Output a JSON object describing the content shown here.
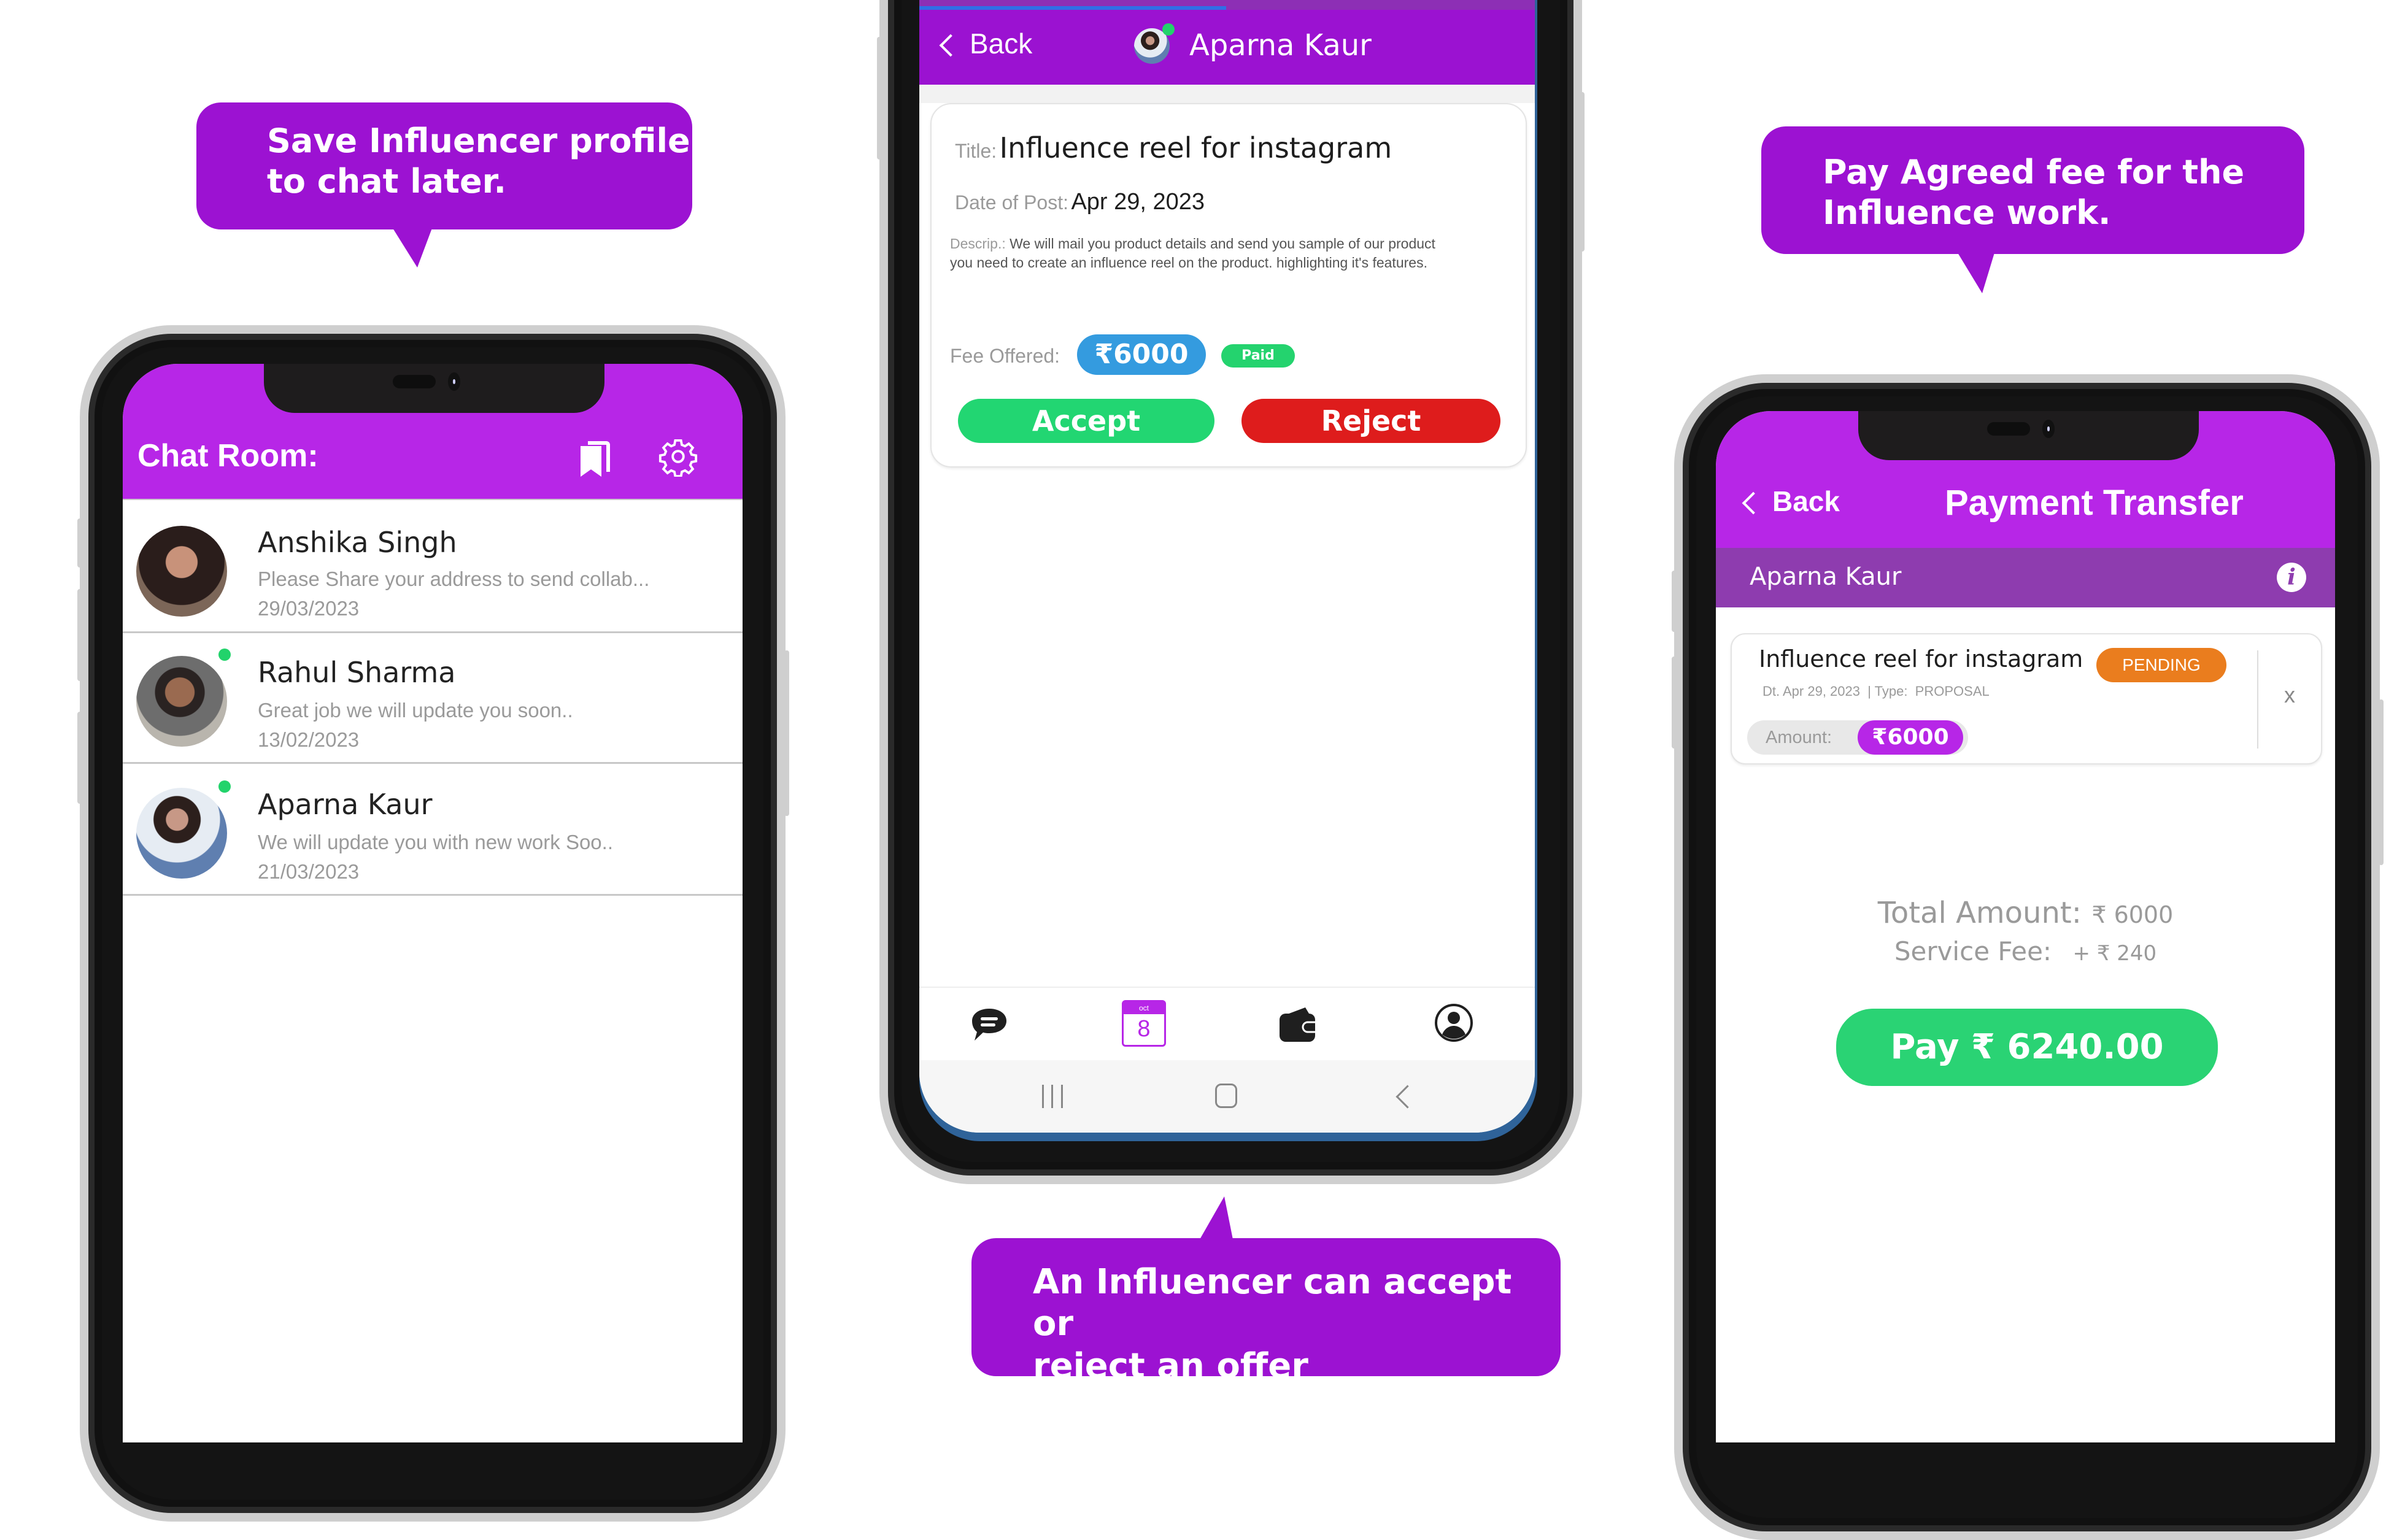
{
  "callouts": {
    "left": {
      "line1": "Save Influencer profile",
      "line2": "to chat later."
    },
    "middle": {
      "line1": "An Influencer can accept or",
      "line2": "reject an offer"
    },
    "right": {
      "line1": "Pay Agreed fee for the",
      "line2": "Influence work."
    }
  },
  "chat_room": {
    "title": "Chat Room:",
    "icons": {
      "bookmark": "bookmark-icon",
      "settings": "gear-icon"
    },
    "chats": [
      {
        "name": "Anshika Singh",
        "message": "Please Share your address to send collab...",
        "date": "29/03/2023",
        "online": false
      },
      {
        "name": "Rahul Sharma",
        "message": "Great job we will update you soon..",
        "date": "13/02/2023",
        "online": true
      },
      {
        "name": "Aparna Kaur",
        "message": "We will update you with new work Soo..",
        "date": "21/03/2023",
        "online": true
      }
    ]
  },
  "offer_screen": {
    "back_label": "Back",
    "contact_name": "Aparna Kaur",
    "title_label": "Title:",
    "title_value": "Influence reel for instagram",
    "date_label": "Date of Post:",
    "date_value": "Apr 29, 2023",
    "desc_label": "Descrip.:",
    "desc_line1": "We will mail you product details and send you sample of our product",
    "desc_line2": "you need to create an influence reel on the product. highlighting it's features.",
    "fee_label": "Fee Offered:",
    "fee_value": "₹6000",
    "paid_badge": "Paid",
    "accept_label": "Accept",
    "reject_label": "Reject",
    "bottom_nav": [
      {
        "icon": "chat-icon"
      },
      {
        "icon": "calendar-icon",
        "month": "oct",
        "day": "8",
        "active": true
      },
      {
        "icon": "wallet-icon"
      },
      {
        "icon": "profile-icon"
      }
    ]
  },
  "payment_screen": {
    "back_label": "Back",
    "title": "Payment Transfer",
    "contact_name": "Aparna Kaur",
    "item_title": "Influence reel for instagram",
    "status": "PENDING",
    "item_meta": "Dt. Apr 29, 2023  | Type:  PROPOSAL",
    "amount_label": "Amount:",
    "amount_value": "₹6000",
    "close_label": "x",
    "total_label": "Total Amount:",
    "total_value": "₹ 6000",
    "fee_label": "Service Fee:",
    "fee_value": "+ ₹ 240",
    "pay_label": "Pay ₹ 6240.00"
  },
  "colors": {
    "primary_purple": "#b726e7",
    "callout_purple": "#9c12d2",
    "accept_green": "#22d672",
    "reject_red": "#de1c1c",
    "fee_blue": "#349bdf",
    "pending_orange": "#ea7d1e"
  }
}
